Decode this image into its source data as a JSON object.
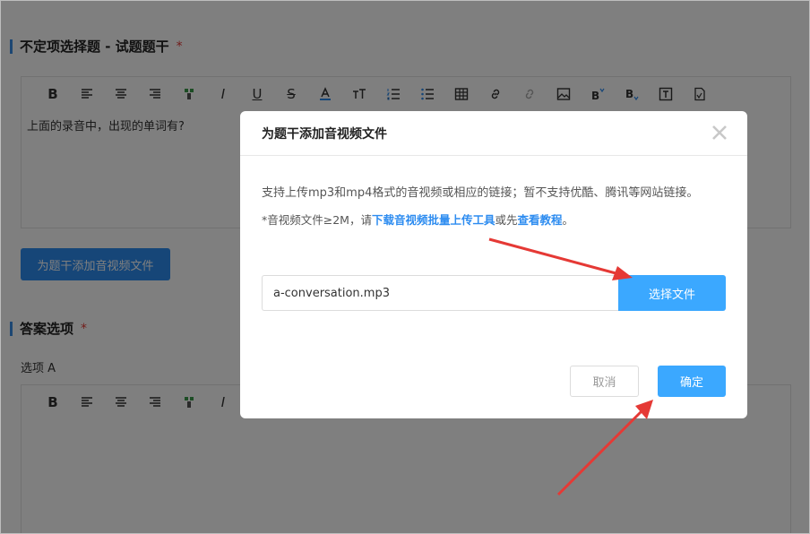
{
  "question": {
    "section_title": "不定项选择题 - 试题题干",
    "required_mark": "*",
    "editor_text": "上面的录音中，出现的单词有?",
    "add_media_label": "为题干添加音视频文件"
  },
  "answers": {
    "section_title": "答案选项",
    "required_mark": "*",
    "option_label": "选项 A"
  },
  "toolbar_icons": [
    "bold-icon",
    "align-left-icon",
    "align-center-icon",
    "align-right-icon",
    "format-painter-icon",
    "italic-icon",
    "underline-icon",
    "strikethrough-icon",
    "font-color-icon",
    "font-size-icon",
    "ordered-list-icon",
    "unordered-list-icon",
    "table-icon",
    "link-icon",
    "unlink-icon",
    "image-icon",
    "superscript-icon",
    "subscript-icon",
    "text-box-icon",
    "formula-icon"
  ],
  "modal": {
    "title": "为题干添加音视频文件",
    "description": "支持上传mp3和mp4格式的音视频或相应的链接；暂不支持优酷、腾讯等网站链接。",
    "note_prefix": "*音视频文件≥2M，请",
    "note_link1": "下载音视频批量上传工具",
    "note_middle": "或先",
    "note_link2": "查看教程",
    "note_suffix": "。",
    "file_value": "a-conversation.mp3",
    "choose_label": "选择文件",
    "cancel_label": "取消",
    "confirm_label": "确定"
  },
  "colors": {
    "accent": "#3ba8ff",
    "primary_button": "#2d8cf0",
    "annotation_arrow": "#e53935"
  }
}
